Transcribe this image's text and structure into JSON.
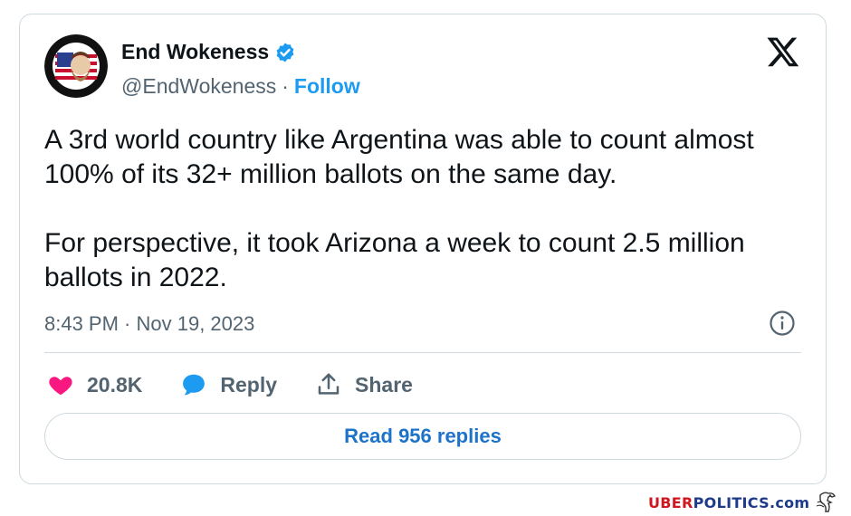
{
  "tweet": {
    "display_name": "End Wokeness",
    "handle": "@EndWokeness",
    "separator": "·",
    "follow_label": "Follow",
    "text": "A 3rd world country like Argentina was able to count almost 100% of its 32+ million ballots on the same day.\n\nFor perspective, it took Arizona a week to count 2.5 million ballots in 2022.",
    "timestamp": "8:43 PM · Nov 19, 2023",
    "likes": "20.8K",
    "reply_label": "Reply",
    "share_label": "Share",
    "read_replies_label": "Read 956 replies"
  },
  "icons": {
    "verified": "verified-badge-icon",
    "platform": "x-logo-icon",
    "info": "info-icon",
    "like": "heart-icon",
    "reply": "speech-bubble-icon",
    "share": "share-upload-icon"
  },
  "colors": {
    "accent": "#1d9bf0",
    "like": "#f91880",
    "text": "#0f1419",
    "muted": "#536471"
  },
  "watermark": {
    "part1": "UBER",
    "part2": "POLITICS",
    "part3": ".com"
  }
}
